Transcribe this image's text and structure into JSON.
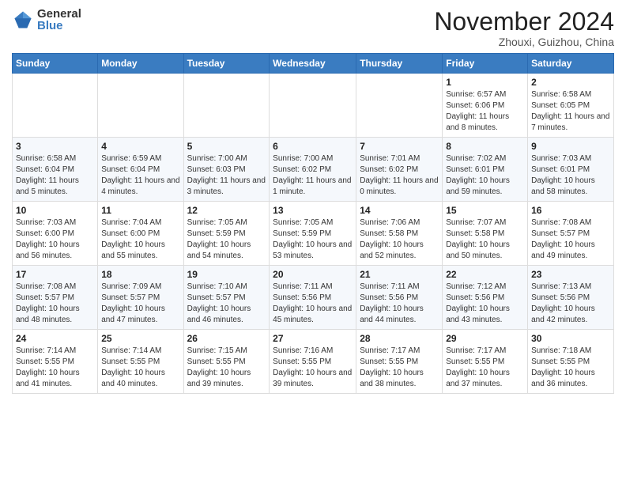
{
  "header": {
    "logo_general": "General",
    "logo_blue": "Blue",
    "month": "November 2024",
    "location": "Zhouxi, Guizhou, China"
  },
  "days_of_week": [
    "Sunday",
    "Monday",
    "Tuesday",
    "Wednesday",
    "Thursday",
    "Friday",
    "Saturday"
  ],
  "weeks": [
    [
      {
        "day": "",
        "info": ""
      },
      {
        "day": "",
        "info": ""
      },
      {
        "day": "",
        "info": ""
      },
      {
        "day": "",
        "info": ""
      },
      {
        "day": "",
        "info": ""
      },
      {
        "day": "1",
        "info": "Sunrise: 6:57 AM\nSunset: 6:06 PM\nDaylight: 11 hours and 8 minutes."
      },
      {
        "day": "2",
        "info": "Sunrise: 6:58 AM\nSunset: 6:05 PM\nDaylight: 11 hours and 7 minutes."
      }
    ],
    [
      {
        "day": "3",
        "info": "Sunrise: 6:58 AM\nSunset: 6:04 PM\nDaylight: 11 hours and 5 minutes."
      },
      {
        "day": "4",
        "info": "Sunrise: 6:59 AM\nSunset: 6:04 PM\nDaylight: 11 hours and 4 minutes."
      },
      {
        "day": "5",
        "info": "Sunrise: 7:00 AM\nSunset: 6:03 PM\nDaylight: 11 hours and 3 minutes."
      },
      {
        "day": "6",
        "info": "Sunrise: 7:00 AM\nSunset: 6:02 PM\nDaylight: 11 hours and 1 minute."
      },
      {
        "day": "7",
        "info": "Sunrise: 7:01 AM\nSunset: 6:02 PM\nDaylight: 11 hours and 0 minutes."
      },
      {
        "day": "8",
        "info": "Sunrise: 7:02 AM\nSunset: 6:01 PM\nDaylight: 10 hours and 59 minutes."
      },
      {
        "day": "9",
        "info": "Sunrise: 7:03 AM\nSunset: 6:01 PM\nDaylight: 10 hours and 58 minutes."
      }
    ],
    [
      {
        "day": "10",
        "info": "Sunrise: 7:03 AM\nSunset: 6:00 PM\nDaylight: 10 hours and 56 minutes."
      },
      {
        "day": "11",
        "info": "Sunrise: 7:04 AM\nSunset: 6:00 PM\nDaylight: 10 hours and 55 minutes."
      },
      {
        "day": "12",
        "info": "Sunrise: 7:05 AM\nSunset: 5:59 PM\nDaylight: 10 hours and 54 minutes."
      },
      {
        "day": "13",
        "info": "Sunrise: 7:05 AM\nSunset: 5:59 PM\nDaylight: 10 hours and 53 minutes."
      },
      {
        "day": "14",
        "info": "Sunrise: 7:06 AM\nSunset: 5:58 PM\nDaylight: 10 hours and 52 minutes."
      },
      {
        "day": "15",
        "info": "Sunrise: 7:07 AM\nSunset: 5:58 PM\nDaylight: 10 hours and 50 minutes."
      },
      {
        "day": "16",
        "info": "Sunrise: 7:08 AM\nSunset: 5:57 PM\nDaylight: 10 hours and 49 minutes."
      }
    ],
    [
      {
        "day": "17",
        "info": "Sunrise: 7:08 AM\nSunset: 5:57 PM\nDaylight: 10 hours and 48 minutes."
      },
      {
        "day": "18",
        "info": "Sunrise: 7:09 AM\nSunset: 5:57 PM\nDaylight: 10 hours and 47 minutes."
      },
      {
        "day": "19",
        "info": "Sunrise: 7:10 AM\nSunset: 5:57 PM\nDaylight: 10 hours and 46 minutes."
      },
      {
        "day": "20",
        "info": "Sunrise: 7:11 AM\nSunset: 5:56 PM\nDaylight: 10 hours and 45 minutes."
      },
      {
        "day": "21",
        "info": "Sunrise: 7:11 AM\nSunset: 5:56 PM\nDaylight: 10 hours and 44 minutes."
      },
      {
        "day": "22",
        "info": "Sunrise: 7:12 AM\nSunset: 5:56 PM\nDaylight: 10 hours and 43 minutes."
      },
      {
        "day": "23",
        "info": "Sunrise: 7:13 AM\nSunset: 5:56 PM\nDaylight: 10 hours and 42 minutes."
      }
    ],
    [
      {
        "day": "24",
        "info": "Sunrise: 7:14 AM\nSunset: 5:55 PM\nDaylight: 10 hours and 41 minutes."
      },
      {
        "day": "25",
        "info": "Sunrise: 7:14 AM\nSunset: 5:55 PM\nDaylight: 10 hours and 40 minutes."
      },
      {
        "day": "26",
        "info": "Sunrise: 7:15 AM\nSunset: 5:55 PM\nDaylight: 10 hours and 39 minutes."
      },
      {
        "day": "27",
        "info": "Sunrise: 7:16 AM\nSunset: 5:55 PM\nDaylight: 10 hours and 39 minutes."
      },
      {
        "day": "28",
        "info": "Sunrise: 7:17 AM\nSunset: 5:55 PM\nDaylight: 10 hours and 38 minutes."
      },
      {
        "day": "29",
        "info": "Sunrise: 7:17 AM\nSunset: 5:55 PM\nDaylight: 10 hours and 37 minutes."
      },
      {
        "day": "30",
        "info": "Sunrise: 7:18 AM\nSunset: 5:55 PM\nDaylight: 10 hours and 36 minutes."
      }
    ]
  ]
}
